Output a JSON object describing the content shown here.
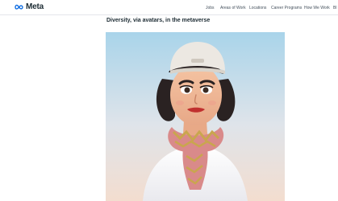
{
  "header": {
    "brand": "Meta",
    "logo_icon": "meta-infinity-logo",
    "brand_color": "#0668E1",
    "nav": [
      {
        "label": "Jobs"
      },
      {
        "label": "Areas of Work"
      },
      {
        "label": "Locations"
      },
      {
        "label": "Career Programs"
      },
      {
        "label": "How We Work"
      },
      {
        "label": "Bl"
      }
    ]
  },
  "article": {
    "title": "Diversity, via avatars, in the metaverse"
  },
  "hero_image": {
    "subject": "avatar"
  }
}
